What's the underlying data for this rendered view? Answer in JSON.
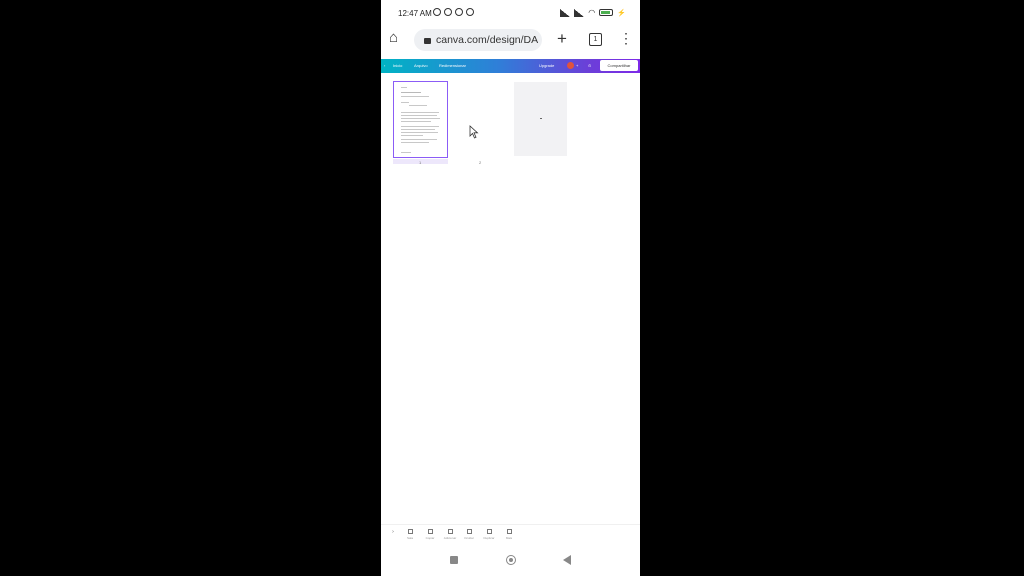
{
  "status": {
    "time": "12:47 AM"
  },
  "browser": {
    "url": "canva.com/design/DA",
    "tab_count": "1"
  },
  "canva": {
    "home": "Inicio",
    "resize": "Arquivo",
    "magic": "Redimensionar",
    "upgrade": "Upgrade",
    "share": "Compartilhar",
    "accent": "#7d2ae8"
  },
  "pages": {
    "page1_number": "1",
    "page2_number": "2"
  },
  "toolbar": {
    "items": [
      "Sala",
      "Copiar",
      "Adicionar",
      "Ocultar",
      "Duplicar",
      "Mais"
    ]
  }
}
